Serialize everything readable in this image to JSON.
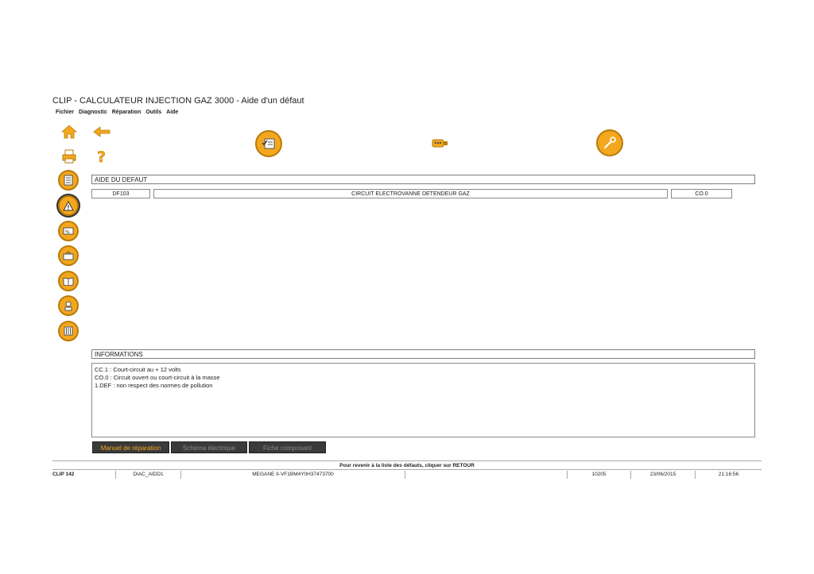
{
  "window": {
    "title": "CLIP - CALCULATEUR INJECTION GAZ 3000 - Aide d'un défaut"
  },
  "menu": [
    "Fichier",
    "Diagnostic",
    "Réparation",
    "Outils",
    "Aide"
  ],
  "colors": {
    "accent": "#f3a71e",
    "accent_dark": "#b97b08",
    "button_bg": "#3a3a3a"
  },
  "toolbar": {
    "left": [
      "home-icon",
      "back-arrow-icon",
      "print-icon",
      "help-icon"
    ],
    "center": [
      "checklist-icon",
      "connector-icon",
      "wrench-icon"
    ]
  },
  "sidebar": [
    "document-icon",
    "warning-icon",
    "parameter-icon",
    "status-icon",
    "book-icon",
    "actuator-icon",
    "barcode-icon"
  ],
  "fault_help": {
    "header": "AIDE DU DEFAUT",
    "code": "DF103",
    "description": "CIRCUIT ELECTROVANNE DETENDEUR GAZ",
    "characterization": "CO.0"
  },
  "informations": {
    "header": "INFORMATIONS",
    "lines": [
      "CC.1  :  Court-circuit au + 12 volts",
      "CO.0  :  Circuit ouvert ou court-circuit à la masse",
      "1.DEF  :  non respect des normes de pollution"
    ]
  },
  "buttons": {
    "manual": "Manuel de réparation",
    "schema": "Schéma électrique",
    "component": "Fiche composant"
  },
  "hint": "Pour revenir à la liste des défauts, cliquer sur RETOUR",
  "status": {
    "clip": "CLIP 142",
    "diag": "DIAC_AIDD1",
    "vehicle": "MEGANE II-VF1BM4Y0H37473700",
    "empty": "",
    "code": "10205",
    "date": "23/06/2015",
    "time": "21:16:56"
  }
}
